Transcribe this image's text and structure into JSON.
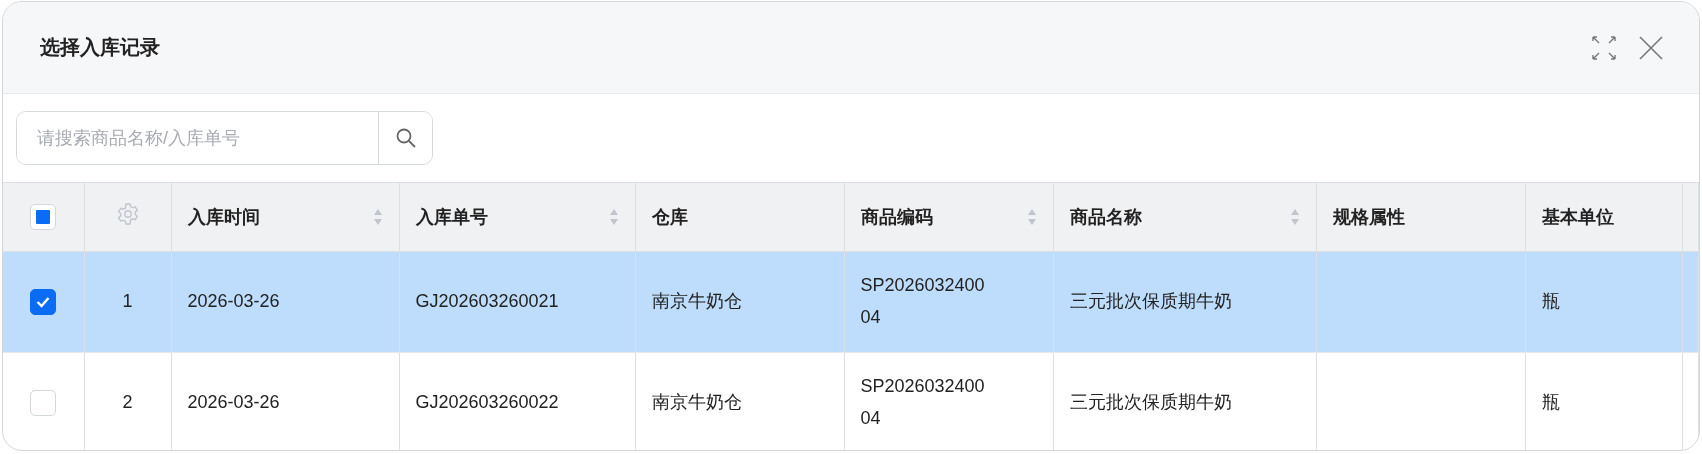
{
  "dialog": {
    "title": "选择入库记录"
  },
  "search": {
    "placeholder": "请搜索商品名称/入库单号"
  },
  "table": {
    "select_all": {
      "indeterminate": true
    },
    "columns": [
      {
        "label": "入库时间",
        "sortable": true
      },
      {
        "label": "入库单号",
        "sortable": true
      },
      {
        "label": "仓库",
        "sortable": false
      },
      {
        "label": "商品编码",
        "sortable": true
      },
      {
        "label": "商品名称",
        "sortable": true
      },
      {
        "label": "规格属性",
        "sortable": false
      },
      {
        "label": "基本单位",
        "sortable": false
      }
    ],
    "rows": [
      {
        "selected": true,
        "index": "1",
        "cells": [
          "2026-03-26",
          "GJ202603260021",
          "南京牛奶仓",
          "SP2026032400 04",
          "三元批次保质期牛奶",
          "",
          "瓶"
        ]
      },
      {
        "selected": false,
        "index": "2",
        "cells": [
          "2026-03-26",
          "GJ202603260022",
          "南京牛奶仓",
          "SP2026032400 04",
          "三元批次保质期牛奶",
          "",
          "瓶"
        ]
      }
    ]
  }
}
